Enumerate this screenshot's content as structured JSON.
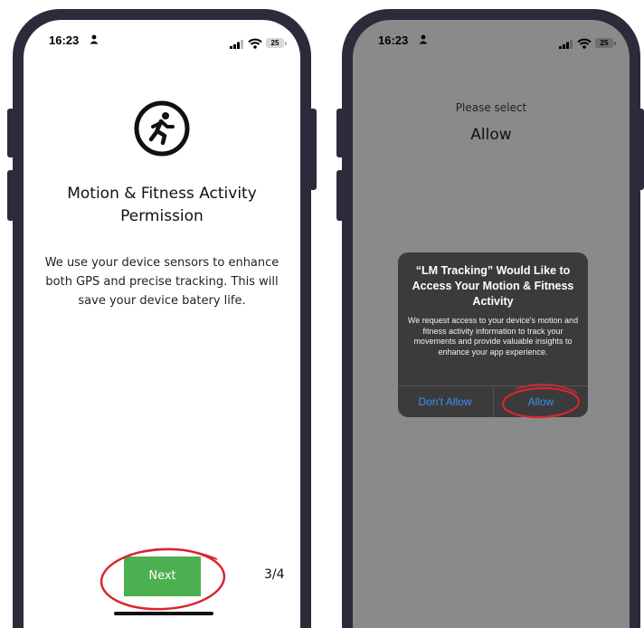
{
  "status_bar": {
    "time": "16:23",
    "battery": "25"
  },
  "left_screen": {
    "title": "Motion & Fitness Activity Permission",
    "description": "We use your device sensors to enhance both GPS and precise tracking. This will save your device batery life.",
    "next_label": "Next",
    "page_indicator": "3/4",
    "icon": "running-person-icon"
  },
  "right_screen": {
    "hint": "Please select",
    "hint_value": "Allow",
    "alert": {
      "title": "“LM Tracking” Would Like to Access Your Motion & Fitness Activity",
      "message": "We request access to your device's motion and fitness activity information to track your movements and provide valuable insights to enhance your app experience.",
      "deny_label": "Don't Allow",
      "allow_label": "Allow"
    }
  },
  "colors": {
    "phone_frame": "#2e2a3b",
    "next_button": "#4caf50",
    "alert_background": "#3b3b3b",
    "alert_link": "#3d8ef2",
    "highlight_circle": "#d8262e",
    "dim_overlay": "#8a8a8a"
  }
}
